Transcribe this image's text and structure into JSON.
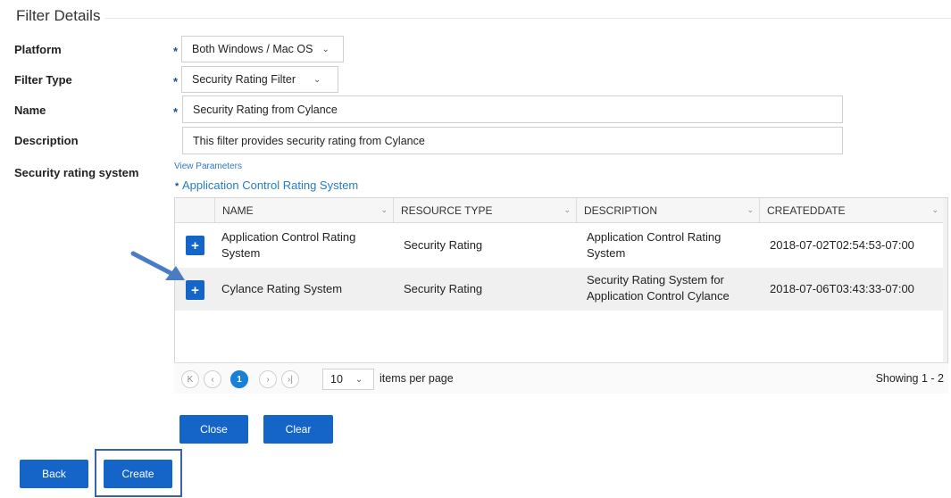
{
  "section_title": "Filter Details",
  "fields": {
    "platform_label": "Platform",
    "platform_value": "Both Windows / Mac OS",
    "filter_type_label": "Filter Type",
    "filter_type_value": "Security Rating Filter",
    "name_label": "Name",
    "name_value": "Security Rating from Cylance",
    "description_label": "Description",
    "description_value": "This filter provides security rating from Cylance",
    "rating_system_label": "Security rating system",
    "view_parameters": "View Parameters",
    "selected_rating_system": "Application Control Rating System",
    "required_marker": "*"
  },
  "grid": {
    "columns": [
      "NAME",
      "RESOURCE TYPE",
      "DESCRIPTION",
      "CREATEDDATE"
    ],
    "rows": [
      {
        "name_l1": "Application Control Rating",
        "name_l2": "System",
        "type": "Security Rating",
        "desc_l1": "Application Control Rating",
        "desc_l2": "System",
        "date": "2018-07-02T02:54:53-07:00"
      },
      {
        "name_l1": "Cylance Rating System",
        "name_l2": "",
        "type": "Security Rating",
        "desc_l1": "Security Rating System for",
        "desc_l2": "Application Control Cylance",
        "date": "2018-07-06T03:43:33-07:00"
      }
    ],
    "add_symbol": "+",
    "pager": {
      "first": "K",
      "prev": "‹",
      "current": "1",
      "next": "›",
      "last": "›|",
      "page_size": "10",
      "items_per_page": "items per page",
      "showing": "Showing 1 - 2"
    }
  },
  "buttons": {
    "close": "Close",
    "clear": "Clear",
    "back": "Back",
    "create": "Create"
  },
  "colors": {
    "primary": "#1565c8",
    "link": "#2a7ac9",
    "highlight_box": "#3b63a8",
    "arrow": "#4a7cc4"
  }
}
